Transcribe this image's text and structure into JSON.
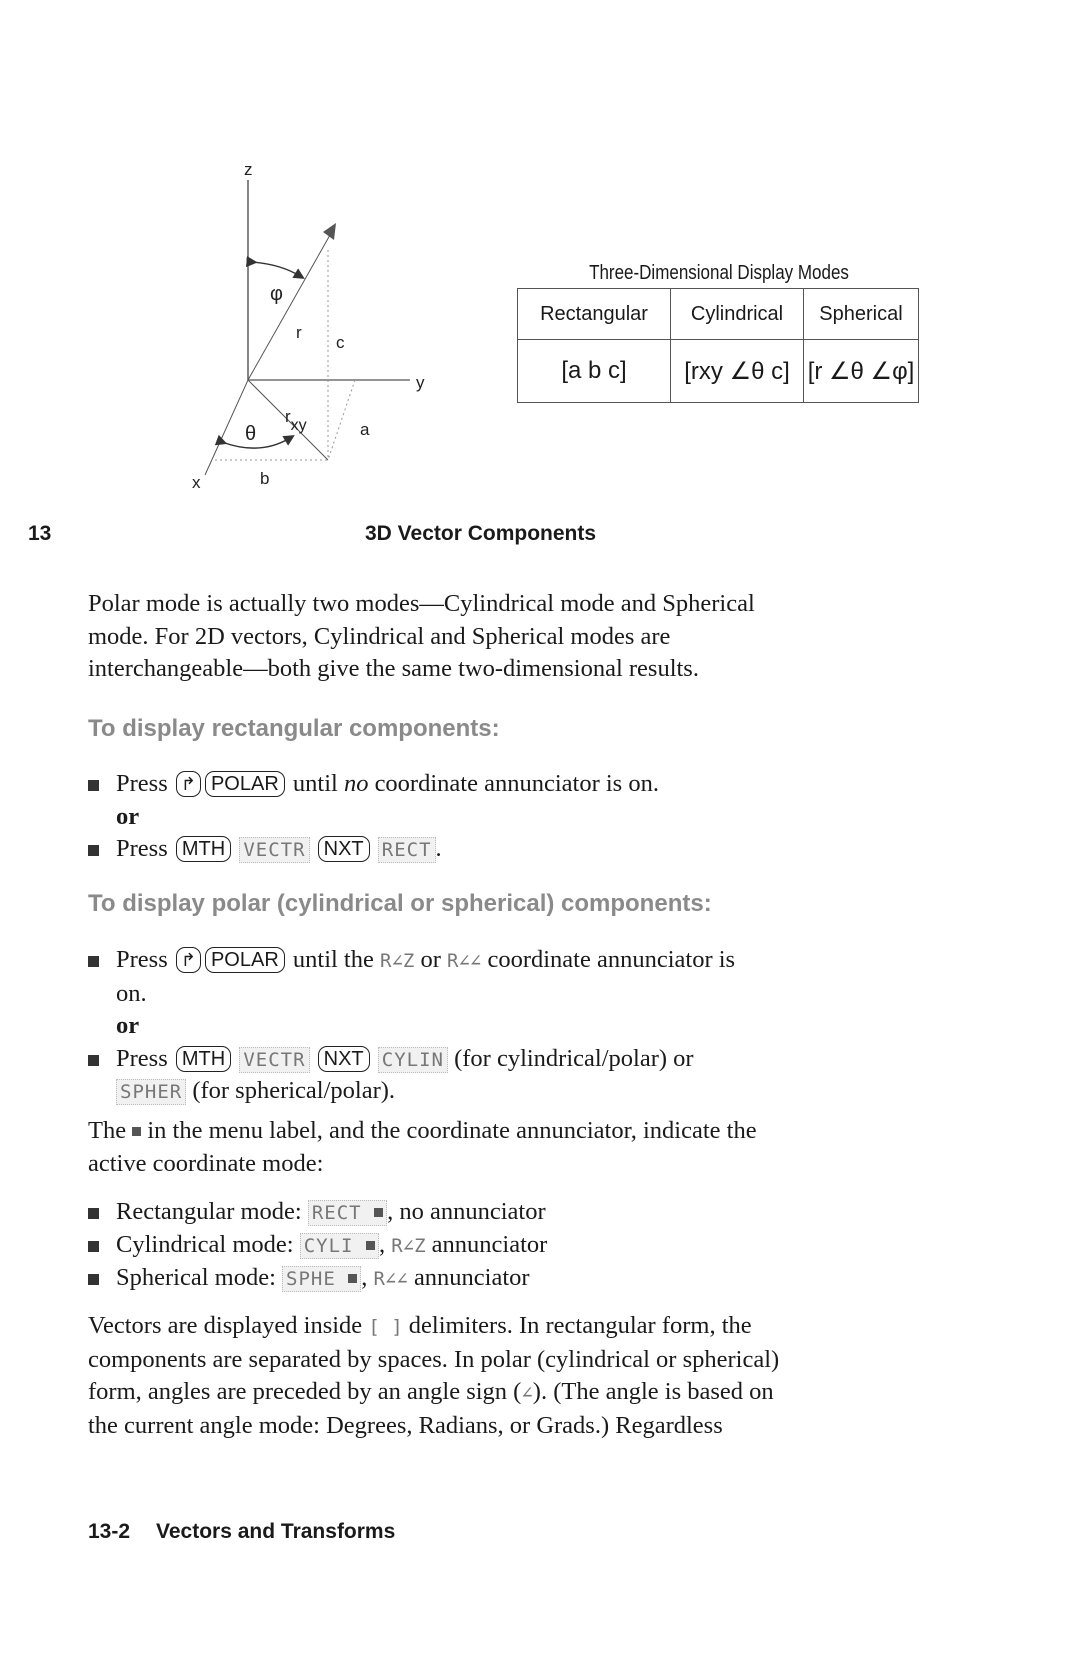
{
  "diagram": {
    "axis_labels": {
      "z": "z",
      "y": "y",
      "x": "x"
    },
    "labels": {
      "phi": "φ",
      "r": "r",
      "c": "c",
      "theta": "θ",
      "rxy_r": "r",
      "rxy_sub": "xy",
      "a": "a",
      "b": "b"
    }
  },
  "modes_table": {
    "caption": "Three-Dimensional Display Modes",
    "headers": [
      "Rectangular",
      "Cylindrical",
      "Spherical"
    ],
    "row": [
      "[a b c]",
      "[rxy ∠θ c]",
      "[r ∠θ ∠φ]"
    ]
  },
  "chapter_tab": "13",
  "section_title": "3D Vector Components",
  "intro_paragraph": [
    "Polar mode is actually two modes—Cylindrical mode and Spherical",
    "mode. For 2D vectors, Cylindrical and Spherical modes are",
    "interchangeable—both give the same two-dimensional results."
  ],
  "rect_section": {
    "heading": "To display rectangular components:",
    "step1": {
      "press": "Press",
      "key1": "↱",
      "key2": "POLAR",
      "text_before": "until ",
      "emph": "no",
      "text_after": " coordinate annunciator is on."
    },
    "or": "or",
    "step2": {
      "press": "Press",
      "key1": "MTH",
      "menu1": "VECTR",
      "key2": "NXT",
      "menu2": "RECT",
      "end": "."
    }
  },
  "polar_section": {
    "heading": "To display polar (cylindrical or spherical) components:",
    "step1": {
      "press": "Press",
      "key1": "↱",
      "key2": "POLAR",
      "t1": "until the",
      "ann1": "R∠Z",
      "t2": "or",
      "ann2": "R∠∠",
      "t3": "coordinate annunciator is",
      "t4": "on."
    },
    "or": "or",
    "step2": {
      "press": "Press",
      "key1": "MTH",
      "menu1": "VECTR",
      "key2": "NXT",
      "menu2": "CYLIN",
      "t1": "(for cylindrical/polar) or",
      "menu3": "SPHER",
      "t2": "(for spherical/polar)."
    }
  },
  "indicator_paragraph": {
    "t1": "The",
    "t2": "in the menu label, and the coordinate annunciator, indicate the",
    "line2": "active coordinate mode:"
  },
  "mode_list": [
    {
      "label": "Rectangular mode:",
      "menu": "RECT",
      "text": ", no annunciator",
      "ann": ""
    },
    {
      "label": "Cylindrical mode:",
      "menu": "CYLI",
      "text": "annunciator",
      "ann": "R∠Z"
    },
    {
      "label": "Spherical mode:",
      "menu": "SPHE",
      "text": "annunciator",
      "ann": "R∠∠"
    }
  ],
  "vectors_paragraph": {
    "l1a": "Vectors are displayed inside",
    "delims": "[ ]",
    "l1b": "delimiters. In rectangular form, the",
    "l2": "components are separated by spaces. In polar (cylindrical or spherical)",
    "l3a": "form, angles are preceded by an angle sign (",
    "angle": "∠",
    "l3b": "). (The angle is based on",
    "l4": "the current angle mode: Degrees, Radians, or Grads.) Regardless"
  },
  "footer": {
    "page": "13-2",
    "section": "Vectors and Transforms"
  }
}
